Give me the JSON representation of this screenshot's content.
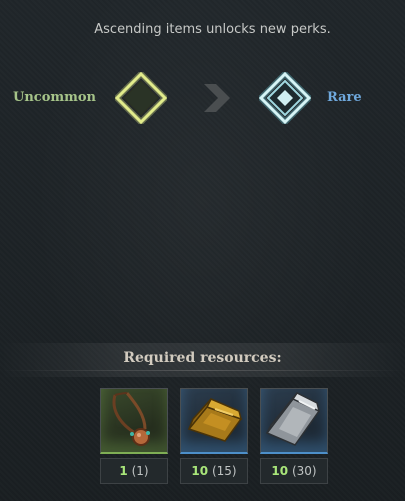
{
  "subtitle": "Ascending items unlocks new perks.",
  "ascension": {
    "from": {
      "label": "Uncommon",
      "color": "#a6c489",
      "icon": "uncommon-rarity-diamond-icon"
    },
    "to": {
      "label": "Rare",
      "color": "#6fa8dc",
      "icon": "rare-rarity-diamond-icon"
    },
    "arrow_icon": "chevron-right-icon"
  },
  "required": {
    "title": "Required resources:",
    "items": [
      {
        "icon": "amulet-necklace-icon",
        "have": "1",
        "need": "(1)",
        "frame_color": "#7fae55"
      },
      {
        "icon": "gold-bar-icon",
        "have": "10",
        "need": "(15)",
        "frame_color": "#4d8fc9"
      },
      {
        "icon": "iron-bar-icon",
        "have": "10",
        "need": "(30)",
        "frame_color": "#4d8fc9"
      }
    ]
  }
}
